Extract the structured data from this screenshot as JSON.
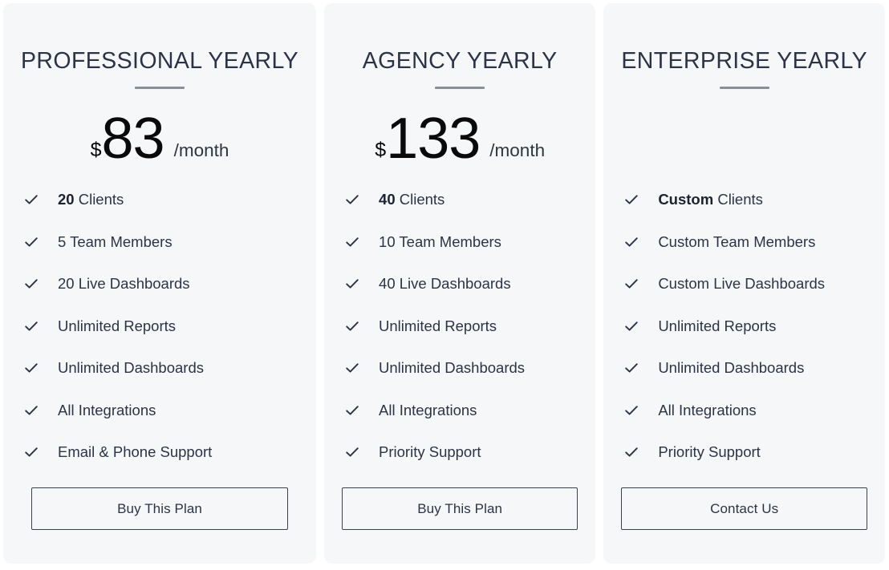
{
  "plans": [
    {
      "title": "PROFESSIONAL YEARLY",
      "currency": "$",
      "amount": "83",
      "period": "/month",
      "features": [
        {
          "lead": "20",
          "text": "Clients"
        },
        {
          "lead": "",
          "text": "5 Team Members"
        },
        {
          "lead": "",
          "text": "20 Live Dashboards"
        },
        {
          "lead": "",
          "text": "Unlimited Reports"
        },
        {
          "lead": "",
          "text": "Unlimited Dashboards"
        },
        {
          "lead": "",
          "text": "All Integrations"
        },
        {
          "lead": "",
          "text": "Email & Phone Support"
        }
      ],
      "cta": "Buy This Plan"
    },
    {
      "title": "AGENCY YEARLY",
      "currency": "$",
      "amount": "133",
      "period": "/month",
      "features": [
        {
          "lead": "40",
          "text": "Clients"
        },
        {
          "lead": "",
          "text": "10 Team Members"
        },
        {
          "lead": "",
          "text": "40 Live Dashboards"
        },
        {
          "lead": "",
          "text": "Unlimited Reports"
        },
        {
          "lead": "",
          "text": "Unlimited Dashboards"
        },
        {
          "lead": "",
          "text": "All Integrations"
        },
        {
          "lead": "",
          "text": "Priority Support"
        }
      ],
      "cta": "Buy This Plan"
    },
    {
      "title": "ENTERPRISE YEARLY",
      "currency": "",
      "amount": "",
      "period": "",
      "features": [
        {
          "lead": "Custom",
          "text": "Clients"
        },
        {
          "lead": "",
          "text": "Custom Team Members"
        },
        {
          "lead": "",
          "text": "Custom Live Dashboards"
        },
        {
          "lead": "",
          "text": "Unlimited Reports"
        },
        {
          "lead": "",
          "text": "Unlimited Dashboards"
        },
        {
          "lead": "",
          "text": "All Integrations"
        },
        {
          "lead": "",
          "text": "Priority Support"
        }
      ],
      "cta": "Contact Us"
    }
  ],
  "icons": {
    "check": "check-icon"
  },
  "colors": {
    "card_background": "#f6f7f9",
    "page_background": "#ffffff",
    "title": "#2b3447",
    "price": "#0a0a0a",
    "divider": "#8a8f98",
    "button_border": "#3b414d"
  }
}
